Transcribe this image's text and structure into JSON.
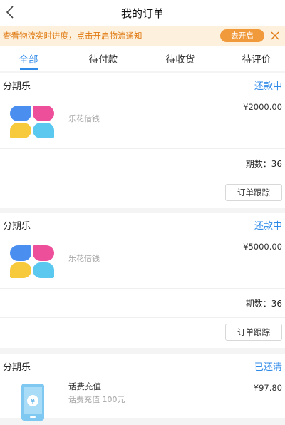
{
  "header": {
    "title": "我的订单",
    "back_icon": "chevron-left-icon"
  },
  "notice": {
    "text": "查看物流实时进度，点击开启物流通知",
    "button_label": "去开启",
    "close_icon": "close-icon",
    "text_color": "#e07a12",
    "button_color": "#f09a3c"
  },
  "tabs": [
    {
      "label": "全部",
      "active": true
    },
    {
      "label": "待付款",
      "active": false
    },
    {
      "label": "待收货",
      "active": false
    },
    {
      "label": "待评价",
      "active": false
    }
  ],
  "colors": {
    "accent": "#2f8ae8"
  },
  "orders": [
    {
      "seller": "分期乐",
      "status": "还款中",
      "item_name": "乐花借钱",
      "price": "¥2000.00",
      "period": "期数：36",
      "action_label": "订单跟踪",
      "icon": "clover-logo-icon"
    },
    {
      "seller": "分期乐",
      "status": "还款中",
      "item_name": "乐花借钱",
      "price": "¥5000.00",
      "period": "期数：36",
      "action_label": "订单跟踪",
      "icon": "clover-logo-icon"
    },
    {
      "seller": "分期乐",
      "status": "已还清",
      "item_title": "话费充值",
      "item_sub": "话费充值 100元",
      "price": "¥97.80",
      "icon": "phone-recharge-icon"
    }
  ]
}
